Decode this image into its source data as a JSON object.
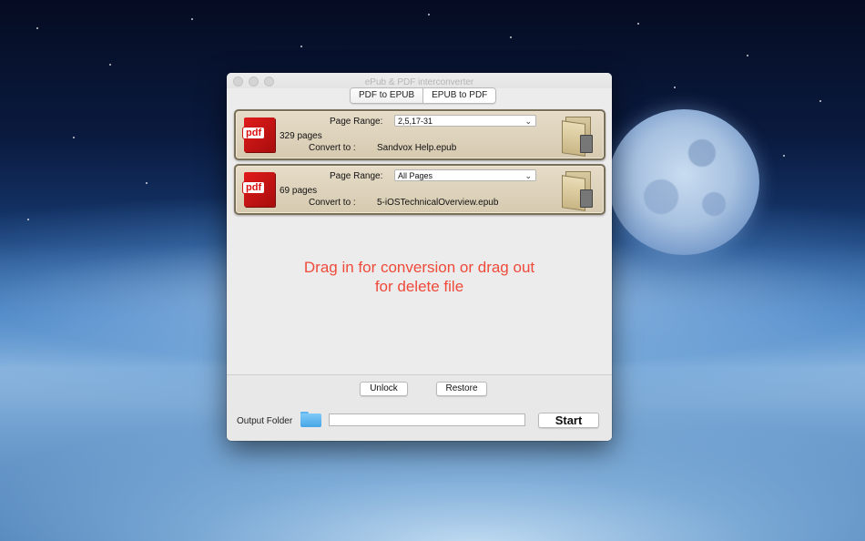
{
  "window": {
    "title": "ePub & PDF interconverter",
    "tabs": [
      {
        "label": "PDF to EPUB",
        "selected": true
      },
      {
        "label": "EPUB to PDF",
        "selected": false
      }
    ]
  },
  "files": [
    {
      "icon": "pdf-icon",
      "icon_label": "pdf",
      "pages": "329 pages",
      "page_range_label": "Page Range:",
      "page_range_value": "2,5,17-31",
      "convert_label": "Convert to :",
      "convert_target": "Sandvox Help.epub"
    },
    {
      "icon": "pdf-icon",
      "icon_label": "pdf",
      "pages": "69 pages",
      "page_range_label": "Page Range:",
      "page_range_value": "All Pages",
      "convert_label": "Convert to :",
      "convert_target": "5-iOSTechnicalOverview.epub"
    }
  ],
  "drop_message": {
    "line1": "Drag in for conversion or drag out",
    "line2": "for delete file"
  },
  "buttons": {
    "unlock": "Unlock",
    "restore": "Restore",
    "start": "Start"
  },
  "output": {
    "label": "Output Folder",
    "path_value": ""
  },
  "colors": {
    "drop_message": "#ef4a3a",
    "card_border": "#7a6f58",
    "card_fill": "#e0d5bd",
    "pdf_red": "#d31414",
    "folder_blue": "#5fb3ee"
  }
}
